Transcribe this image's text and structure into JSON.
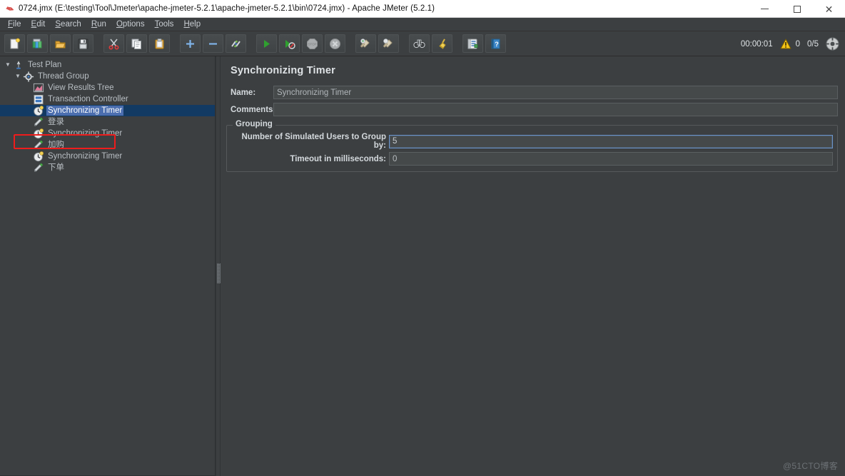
{
  "window": {
    "title": "0724.jmx (E:\\testing\\Tool\\Jmeter\\apache-jmeter-5.2.1\\apache-jmeter-5.2.1\\bin\\0724.jmx) - Apache JMeter (5.2.1)",
    "app_icon": "jmeter-feather-icon",
    "controls": {
      "minimize": "minimize-icon",
      "maximize": "maximize-icon",
      "close": "close-icon"
    }
  },
  "menubar": {
    "items": [
      {
        "label": "File",
        "mnemonic": "F"
      },
      {
        "label": "Edit",
        "mnemonic": "E"
      },
      {
        "label": "Search",
        "mnemonic": "S"
      },
      {
        "label": "Run",
        "mnemonic": "R"
      },
      {
        "label": "Options",
        "mnemonic": "O"
      },
      {
        "label": "Tools",
        "mnemonic": "T"
      },
      {
        "label": "Help",
        "mnemonic": "H"
      }
    ]
  },
  "toolbar": {
    "buttons": [
      {
        "name": "new-test-plan-button",
        "icon": "new-document-icon",
        "tooltip": "New",
        "disabled": false,
        "group_end": false
      },
      {
        "name": "templates-button",
        "icon": "templates-icon",
        "tooltip": "Templates",
        "disabled": false,
        "group_end": false
      },
      {
        "name": "open-button",
        "icon": "open-folder-icon",
        "tooltip": "Open",
        "disabled": false,
        "group_end": false
      },
      {
        "name": "save-button",
        "icon": "save-floppy-icon",
        "tooltip": "Save Test Plan",
        "disabled": false,
        "group_end": true
      },
      {
        "name": "cut-button",
        "icon": "scissors-icon",
        "tooltip": "Cut",
        "disabled": false,
        "group_end": false
      },
      {
        "name": "copy-button",
        "icon": "copy-icon",
        "tooltip": "Copy",
        "disabled": false,
        "group_end": false
      },
      {
        "name": "paste-button",
        "icon": "clipboard-paste-icon",
        "tooltip": "Paste",
        "disabled": false,
        "group_end": true
      },
      {
        "name": "expand-all-button",
        "icon": "plus-icon",
        "tooltip": "Expand All",
        "disabled": false,
        "group_end": false
      },
      {
        "name": "collapse-all-button",
        "icon": "minus-icon",
        "tooltip": "Collapse All",
        "disabled": false,
        "group_end": false
      },
      {
        "name": "toggle-button",
        "icon": "toggle-pencil-icon",
        "tooltip": "Toggle",
        "disabled": false,
        "group_end": true
      },
      {
        "name": "start-button",
        "icon": "play-icon",
        "tooltip": "Start",
        "disabled": false,
        "group_end": false
      },
      {
        "name": "start-no-pauses-button",
        "icon": "play-no-pauses-icon",
        "tooltip": "Start no pauses",
        "disabled": false,
        "group_end": false
      },
      {
        "name": "stop-button",
        "icon": "stop-sign-icon",
        "tooltip": "Stop",
        "disabled": true,
        "group_end": false
      },
      {
        "name": "shutdown-button",
        "icon": "shutdown-icon",
        "tooltip": "Shutdown",
        "disabled": true,
        "group_end": true
      },
      {
        "name": "clear-button",
        "icon": "clear-broom-icon",
        "tooltip": "Clear",
        "disabled": false,
        "group_end": false
      },
      {
        "name": "clear-all-button",
        "icon": "clear-all-broom-icon",
        "tooltip": "Clear All",
        "disabled": false,
        "group_end": true
      },
      {
        "name": "search-button",
        "icon": "binoculars-icon",
        "tooltip": "Search",
        "disabled": false,
        "group_end": false
      },
      {
        "name": "reset-search-button",
        "icon": "broom-icon",
        "tooltip": "Reset Search",
        "disabled": false,
        "group_end": true
      },
      {
        "name": "function-helper-button",
        "icon": "function-helper-icon",
        "tooltip": "Function Helper Dialog",
        "disabled": false,
        "group_end": false
      },
      {
        "name": "help-button",
        "icon": "help-book-icon",
        "tooltip": "Help",
        "disabled": false,
        "group_end": false
      }
    ],
    "status": {
      "elapsed_time": "00:00:01",
      "warning_icon": "warning-triangle-icon",
      "warning_count": "0",
      "threads": "0/5",
      "remote_icon": "remote-engines-icon"
    },
    "colors": {
      "warning": "#f5c518",
      "run": "#2fa02f"
    }
  },
  "tree": {
    "nodes": [
      {
        "label": "Test Plan",
        "icon": "test-plan-icon",
        "indent": 0,
        "twisty": "expanded",
        "selected": false,
        "annotated": false
      },
      {
        "label": "Thread Group",
        "icon": "thread-group-gear-icon",
        "indent": 1,
        "twisty": "expanded",
        "selected": false,
        "annotated": false
      },
      {
        "label": "View Results Tree",
        "icon": "view-results-tree-icon",
        "indent": 2,
        "twisty": "none",
        "selected": false,
        "annotated": true
      },
      {
        "label": "Transaction Controller",
        "icon": "transaction-controller-icon",
        "indent": 2,
        "twisty": "none",
        "selected": false,
        "annotated": false
      },
      {
        "label": "Synchronizing Timer",
        "icon": "timer-clock-icon",
        "indent": 2,
        "twisty": "none",
        "selected": true,
        "annotated": false
      },
      {
        "label": "登录",
        "icon": "http-sampler-pen-icon",
        "indent": 2,
        "twisty": "none",
        "selected": false,
        "annotated": false
      },
      {
        "label": "Synchronizing Timer",
        "icon": "timer-clock-icon",
        "indent": 2,
        "twisty": "none",
        "selected": false,
        "annotated": false
      },
      {
        "label": "加购",
        "icon": "http-sampler-pen-icon",
        "indent": 2,
        "twisty": "none",
        "selected": false,
        "annotated": false
      },
      {
        "label": "Synchronizing Timer",
        "icon": "timer-clock-icon",
        "indent": 2,
        "twisty": "none",
        "selected": false,
        "annotated": false
      },
      {
        "label": "下单",
        "icon": "http-sampler-pen-icon",
        "indent": 2,
        "twisty": "none",
        "selected": false,
        "annotated": false
      }
    ],
    "annotation_color": "#ee1c1c"
  },
  "editor": {
    "title": "Synchronizing Timer",
    "name_label": "Name:",
    "name_value": "Synchronizing Timer",
    "comments_label": "Comments:",
    "comments_value": "",
    "grouping": {
      "legend": "Grouping",
      "users_label": "Number of Simulated Users to Group by:",
      "users_value": "5",
      "users_focused": true,
      "timeout_label": "Timeout in milliseconds:",
      "timeout_value": "0"
    }
  },
  "watermark": "@51CTO博客"
}
